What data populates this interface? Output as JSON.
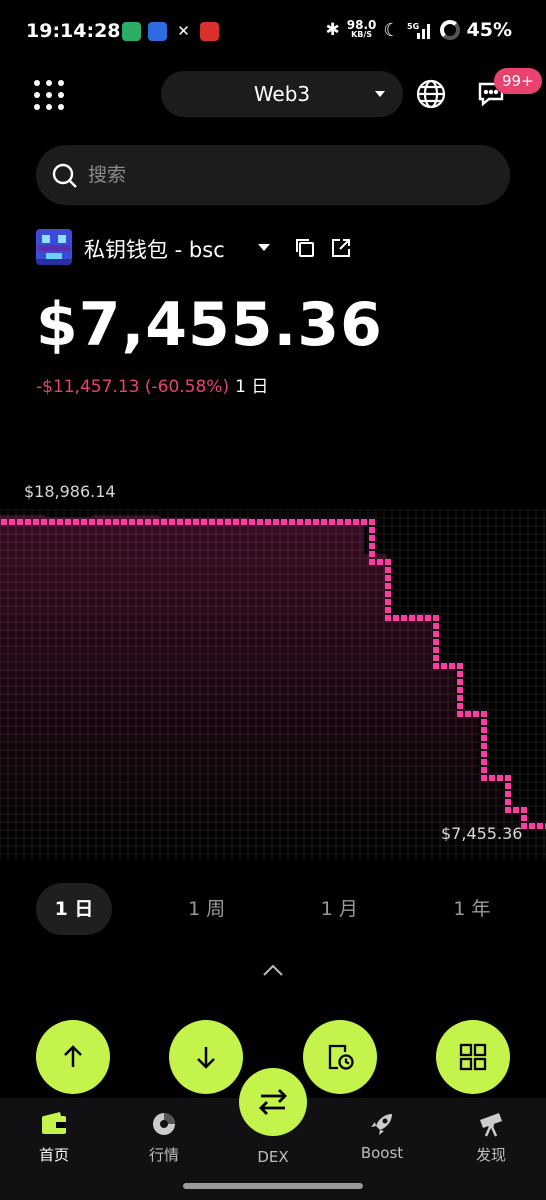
{
  "status_bar": {
    "time": "19:14:28",
    "net_speed_value": "98.0",
    "net_speed_unit": "KB/S",
    "battery": "45%"
  },
  "header": {
    "network": "Web3",
    "badge": "99+",
    "icons": [
      "grid-icon",
      "globe-icon",
      "message-icon"
    ]
  },
  "search": {
    "placeholder": "搜索"
  },
  "wallet": {
    "name": "私钥钱包 - bsc",
    "balance": "$7,455.36",
    "change": "-$11,457.13 (-60.58%)",
    "change_period": "1 日",
    "colors": {
      "accent": "#c4f44b",
      "negative": "#e8436e"
    }
  },
  "chart_data": {
    "type": "line",
    "x": [
      0,
      1,
      2,
      3,
      4,
      5,
      6,
      7,
      8,
      9,
      10,
      11,
      12,
      13,
      14,
      15,
      16,
      17,
      18,
      19,
      20,
      21,
      22,
      23,
      24
    ],
    "values": [
      18986.14,
      18986.14,
      18900,
      18900,
      18980,
      18980,
      18980,
      18880,
      18880,
      18880,
      18880,
      18750,
      18750,
      18750,
      18750,
      18750,
      17500,
      15100,
      15250,
      13300,
      11600,
      9200,
      8000,
      7455.36,
      7455.36
    ],
    "max_label": "$18,986.14",
    "min_label": "$7,455.36",
    "grid": true,
    "color": "#ff3aa0"
  },
  "periods": [
    "1 日",
    "1 周",
    "1 月",
    "1 年"
  ],
  "active_period": 0,
  "actions": [
    {
      "name": "send",
      "icon": "arrow-up-icon"
    },
    {
      "name": "receive",
      "icon": "arrow-down-icon"
    },
    {
      "name": "history",
      "icon": "history-icon"
    },
    {
      "name": "apps",
      "icon": "apps-icon"
    }
  ],
  "bottom_nav": [
    {
      "label": "首页",
      "icon": "wallet-icon"
    },
    {
      "label": "行情",
      "icon": "market-icon"
    },
    {
      "label": "DEX",
      "icon": "swap-icon"
    },
    {
      "label": "Boost",
      "icon": "rocket-icon"
    },
    {
      "label": "发现",
      "icon": "telescope-icon"
    }
  ]
}
